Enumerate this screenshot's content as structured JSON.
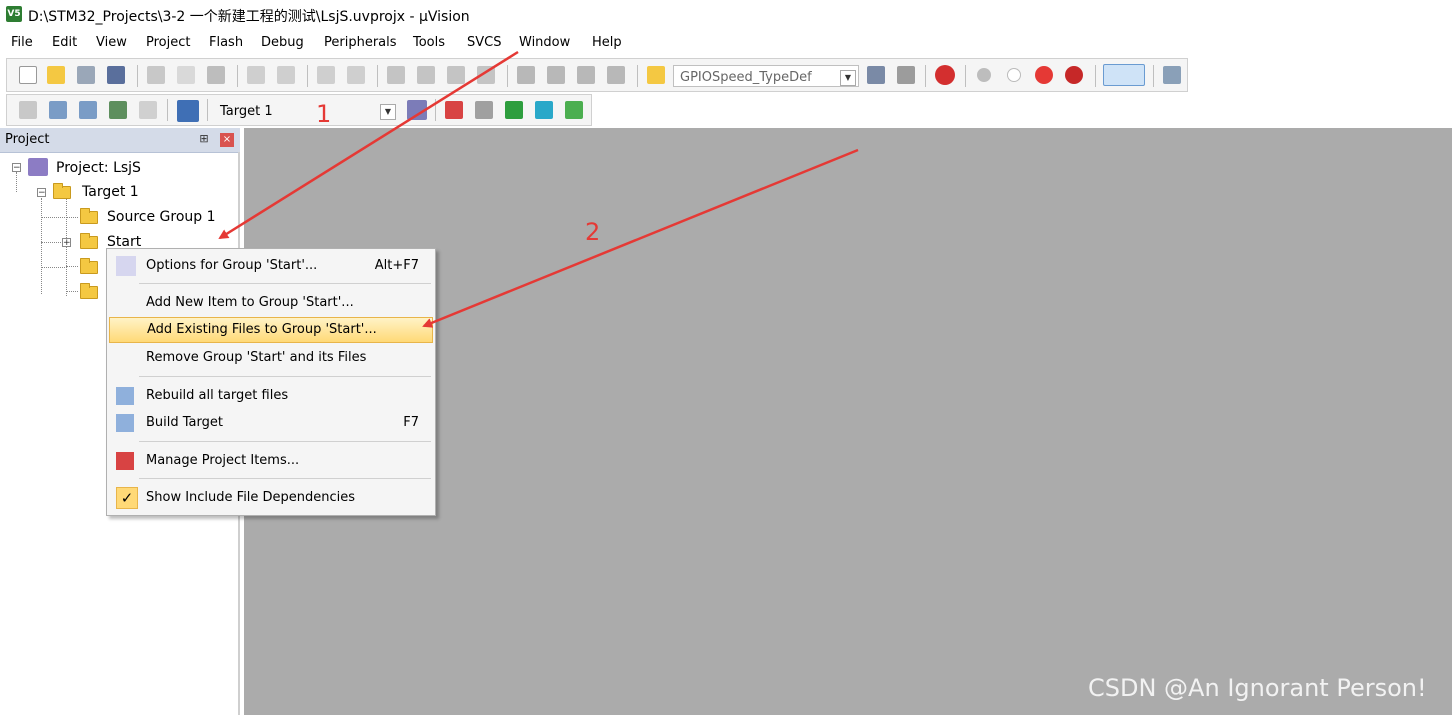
{
  "window": {
    "app_icon": "V5",
    "title": "D:\\STM32_Projects\\3-2 一个新建工程的测试\\LsjS.uvprojx - µVision"
  },
  "menubar": [
    "File",
    "Edit",
    "View",
    "Project",
    "Flash",
    "Debug",
    "Peripherals",
    "Tools",
    "SVCS",
    "Window",
    "Help"
  ],
  "toolbar": {
    "find_combo_value": "GPIOSpeed_TypeDef",
    "target_combo_value": "Target 1"
  },
  "project_panel": {
    "title": "Project",
    "pin_glyph": "⊞",
    "close_glyph": "×",
    "tree": {
      "root": "Project: LsjS",
      "target": "Target 1",
      "groups": [
        "Source Group 1",
        "Start"
      ]
    }
  },
  "context_menu": {
    "items": [
      {
        "label": "Options for Group 'Start'...",
        "shortcut": "Alt+F7",
        "icon": "magic-wand-icon"
      },
      {
        "label": "Add New  Item to Group 'Start'...",
        "shortcut": ""
      },
      {
        "label": "Add Existing Files to Group 'Start'...",
        "shortcut": "",
        "highlighted": true
      },
      {
        "label": "Remove Group 'Start' and its Files",
        "shortcut": ""
      },
      {
        "label": "Rebuild all target files",
        "shortcut": "",
        "icon": "rebuild-icon"
      },
      {
        "label": "Build Target",
        "shortcut": "F7",
        "icon": "build-icon"
      },
      {
        "label": "Manage Project Items...",
        "shortcut": "",
        "icon": "manage-items-icon"
      },
      {
        "label": "Show Include File Dependencies",
        "shortcut": "",
        "icon": "checkmark-icon",
        "check_glyph": "✓"
      }
    ]
  },
  "annotations": {
    "label_1": "1",
    "label_2": "2",
    "color": "#e53935"
  },
  "watermark": "CSDN @An Ignorant Person!",
  "colors": {
    "workspace": "#ababab",
    "highlight": "#ffd977",
    "panel_header": "#d4dbe8"
  }
}
